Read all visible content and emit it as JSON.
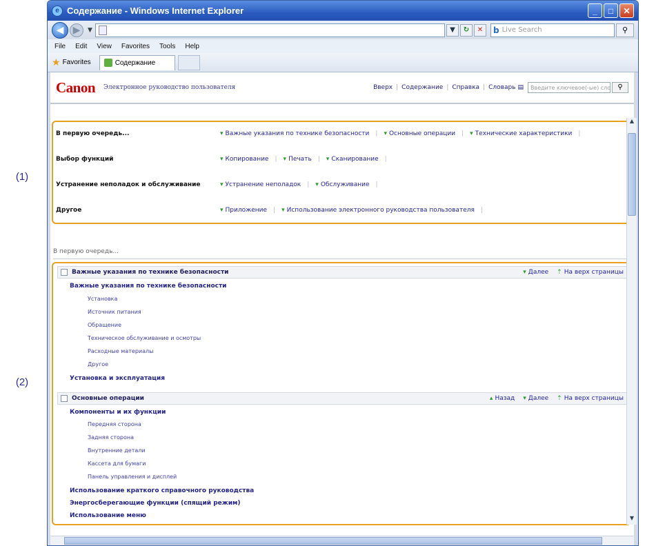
{
  "callouts": {
    "one": "(1)",
    "two": "(2)"
  },
  "window": {
    "title": "Содержание - Windows Internet Explorer",
    "address_placeholder": "",
    "search_placeholder": "Live Search"
  },
  "menu": [
    "File",
    "Edit",
    "View",
    "Favorites",
    "Tools",
    "Help"
  ],
  "favorites": {
    "label": "Favorites",
    "tab_label": "Содержание"
  },
  "page_header": {
    "logo": "Canon",
    "subtitle": "Электронное руководство пользователя",
    "links": [
      "Вверх",
      "Содержание",
      "Справка",
      "Словарь"
    ],
    "search_placeholder": "Введите ключевое(-ые) слово(-а)."
  },
  "quick_menu": [
    {
      "category": "В первую очередь...",
      "links": [
        "Важные указания по технике безопасности",
        "Основные операции",
        "Технические характеристики"
      ]
    },
    {
      "category": "Выбор функций",
      "links": [
        "Копирование",
        "Печать",
        "Сканирование"
      ]
    },
    {
      "category": "Устранение неполадок и обслуживание",
      "links": [
        "Устранение неполадок",
        "Обслуживание"
      ]
    },
    {
      "category": "Другое",
      "links": [
        "Приложение",
        "Использование электронного руководства пользователя"
      ]
    }
  ],
  "breadcrumb": "В первую очередь...",
  "sections": [
    {
      "title": "Важные указания по технике безопасности",
      "nav": [
        "Далее",
        "На верх страницы"
      ],
      "groups": [
        {
          "heading": "Важные указания по технике безопасности",
          "items": [
            "Установка",
            "Источник питания",
            "Обращение",
            "Техническое обслуживание и осмотры",
            "Расходные материалы",
            "Другое"
          ]
        },
        {
          "heading": "Установка и эксплуатация",
          "items": []
        }
      ]
    },
    {
      "title": "Основные операции",
      "nav": [
        "Назад",
        "Далее",
        "На верх страницы"
      ],
      "groups": [
        {
          "heading": "Компоненты и их функции",
          "items": [
            "Передняя сторона",
            "Задняя сторона",
            "Внутренние детали",
            "Кассета для бумаги",
            "Панель управления и дисплей"
          ]
        },
        {
          "heading": "Использование краткого справочного руководства",
          "items": []
        },
        {
          "heading": "Энергосберегающие функции (спящий режим)",
          "items": []
        },
        {
          "heading": "Использование меню",
          "items": []
        }
      ]
    }
  ]
}
